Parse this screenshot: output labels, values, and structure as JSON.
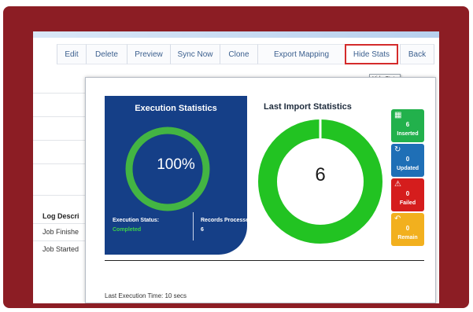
{
  "toolbar": {
    "buttons": [
      {
        "label": "Edit"
      },
      {
        "label": "Delete"
      },
      {
        "label": "Preview"
      },
      {
        "label": "Sync Now"
      },
      {
        "label": "Clone"
      },
      {
        "label": "Export Mapping"
      },
      {
        "label": "Hide Stats"
      },
      {
        "label": "Back"
      }
    ],
    "tooltip": "Hide Stats"
  },
  "background_table": {
    "header": "Log Descri",
    "rows": [
      "Job Finishe",
      "Job Started"
    ]
  },
  "execution": {
    "title": "Execution Statistics",
    "percent_text": "100%",
    "percent_value": 100,
    "status_label": "Execution Status:",
    "status_value": "Completed",
    "records_label": "Records Processed:",
    "records_value": "6"
  },
  "last_import": {
    "title": "Last Import Statistics",
    "total": "6"
  },
  "stats": [
    {
      "label": "Inserted",
      "value": "6",
      "color": "#22b14c",
      "icon": "inserted-icon"
    },
    {
      "label": "Updated",
      "value": "0",
      "color": "#1f6fb6",
      "icon": "refresh-icon"
    },
    {
      "label": "Failed",
      "value": "0",
      "color": "#d51d1d",
      "icon": "warning-icon"
    },
    {
      "label": "Remain",
      "value": "0",
      "color": "#f2b01e",
      "icon": "spinner-icon"
    }
  ],
  "last_execution_time": "Last Execution Time: 10 secs",
  "colors": {
    "frame": "#8c1d24",
    "exec_panel": "#153f87",
    "ring_green": "#43b543",
    "donut_green": "#22c322",
    "status_green": "#3cd14b"
  }
}
